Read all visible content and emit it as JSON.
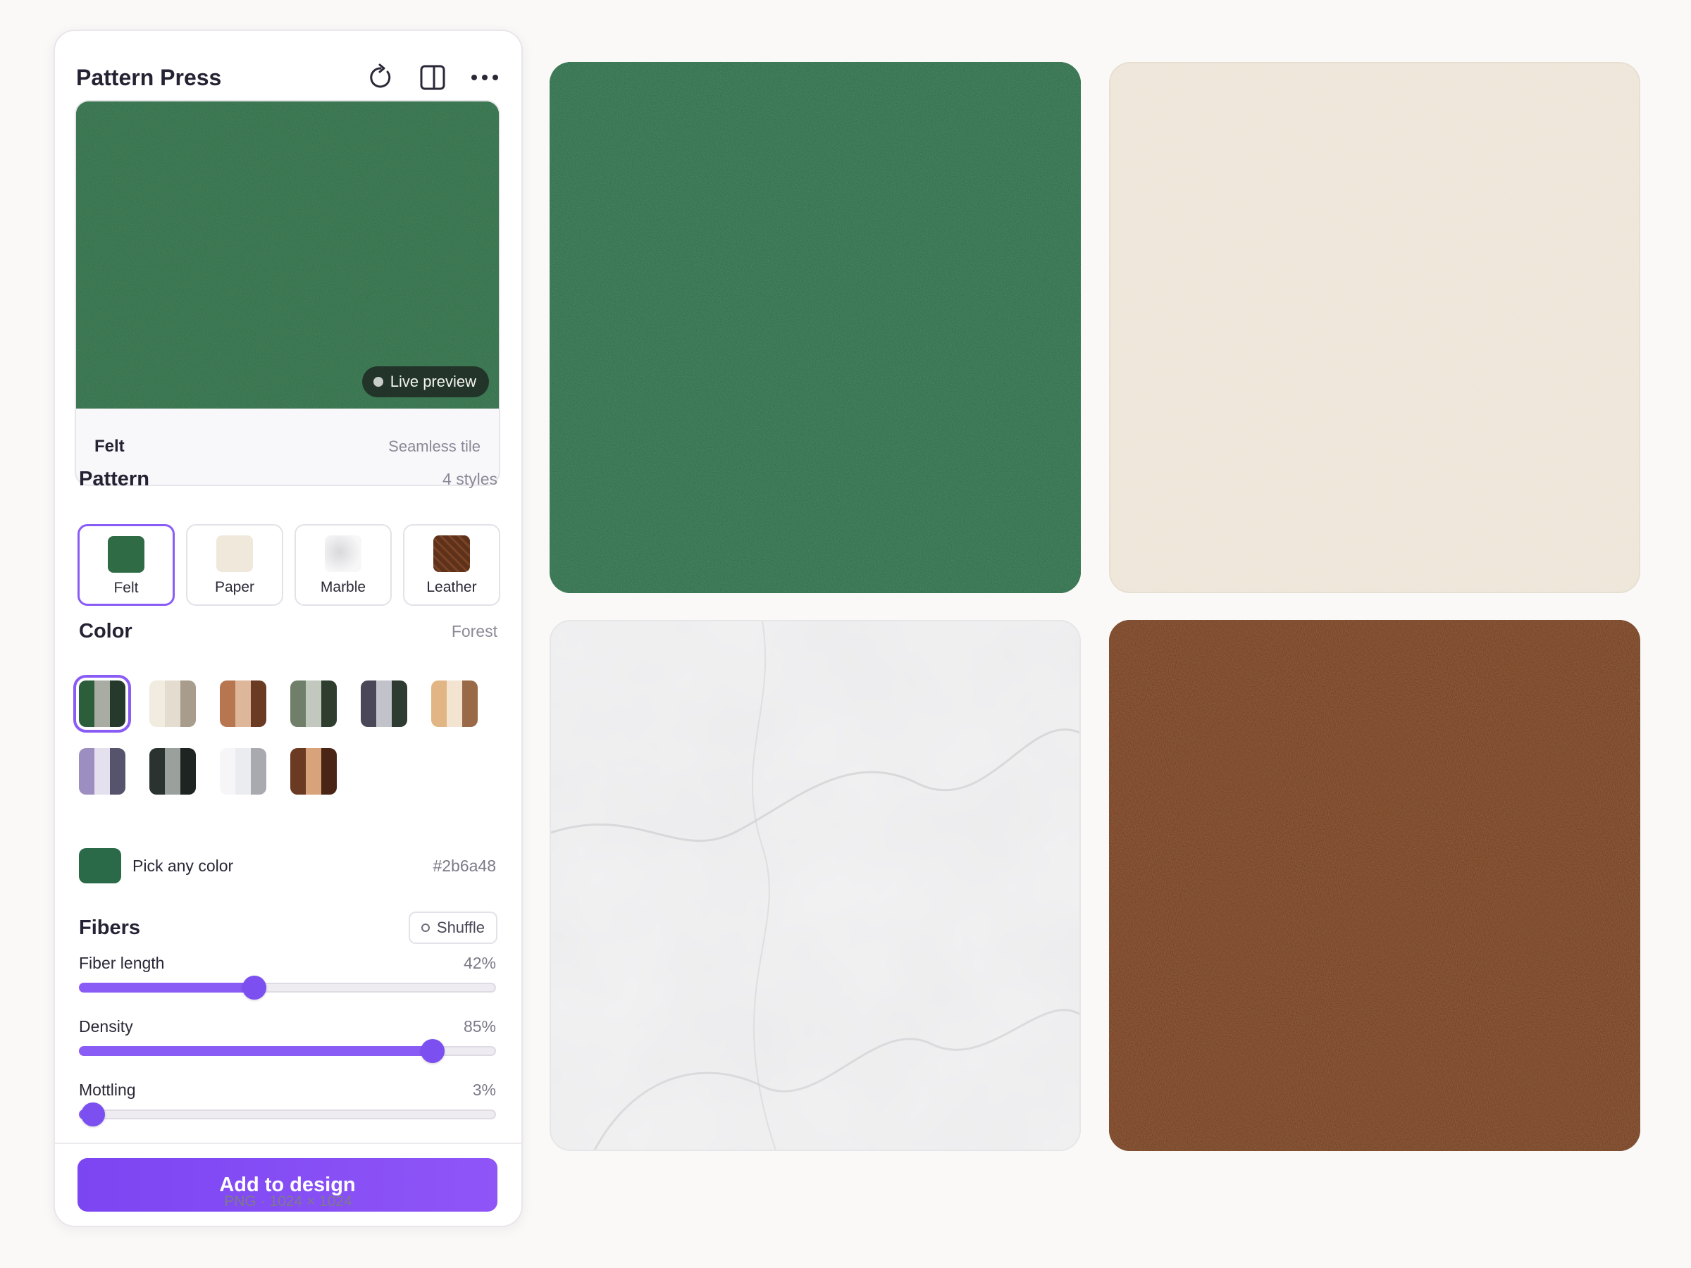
{
  "app": {
    "title": "Pattern Press"
  },
  "header_icons": [
    "refresh-icon",
    "split-view-icon",
    "more-icon"
  ],
  "preview": {
    "badge": "Live preview",
    "name": "Felt",
    "subtitle": "Seamless tile",
    "color": "#2f6b45"
  },
  "pattern": {
    "title": "Pattern",
    "meta": "4 styles",
    "selected": "Felt",
    "items": [
      {
        "label": "Felt",
        "color": "#2f6b45"
      },
      {
        "label": "Paper",
        "color": "#efe8db"
      },
      {
        "label": "Marble",
        "color": "#e7e7e9"
      },
      {
        "label": "Leather",
        "color": "#6b3a1f"
      }
    ]
  },
  "color": {
    "title": "Color",
    "meta": "Forest",
    "selected_index": 0,
    "swatches": [
      [
        "#2d5e3c",
        "#a9aca3",
        "#263a2c"
      ],
      [
        "#f1ebe0",
        "#e3dccf",
        "#a89c8c"
      ],
      [
        "#b77550",
        "#deb69a",
        "#6a3a22"
      ],
      [
        "#6f7f6a",
        "#c3c8bf",
        "#2f3d2f"
      ],
      [
        "#4a4858",
        "#c2c2ca",
        "#2d3b30"
      ],
      [
        "#e2b684",
        "#f2e4d0",
        "#9a6a48"
      ],
      [
        "#9c8ec0",
        "#e4e0ee",
        "#56546c"
      ],
      [
        "#2b3330",
        "#9aa09c",
        "#1d2421"
      ],
      [
        "#f6f6f8",
        "#ebecef",
        "#a9aab0"
      ],
      [
        "#6b3a22",
        "#d8a27a",
        "#4a2414"
      ]
    ],
    "pick_label": "Pick any color",
    "hex": "#2b6a48"
  },
  "fibers": {
    "title": "Fibers",
    "shuffle_label": "Shuffle",
    "sliders": [
      {
        "label": "Fiber length",
        "value_text": "42%",
        "value": 0.42
      },
      {
        "label": "Density",
        "value_text": "85%",
        "value": 0.85
      },
      {
        "label": "Mottling",
        "value_text": "3%",
        "value": 0.03
      }
    ]
  },
  "actions": {
    "add_label": "Add to design",
    "export_note": "PNG · 1024 × 1024"
  },
  "textures": [
    {
      "name": "felt",
      "color": "#2d6a46"
    },
    {
      "name": "paper",
      "color": "#efe8db"
    },
    {
      "name": "marble",
      "color": "#f0f0f0"
    },
    {
      "name": "leather",
      "color": "#6e3b1f"
    }
  ]
}
